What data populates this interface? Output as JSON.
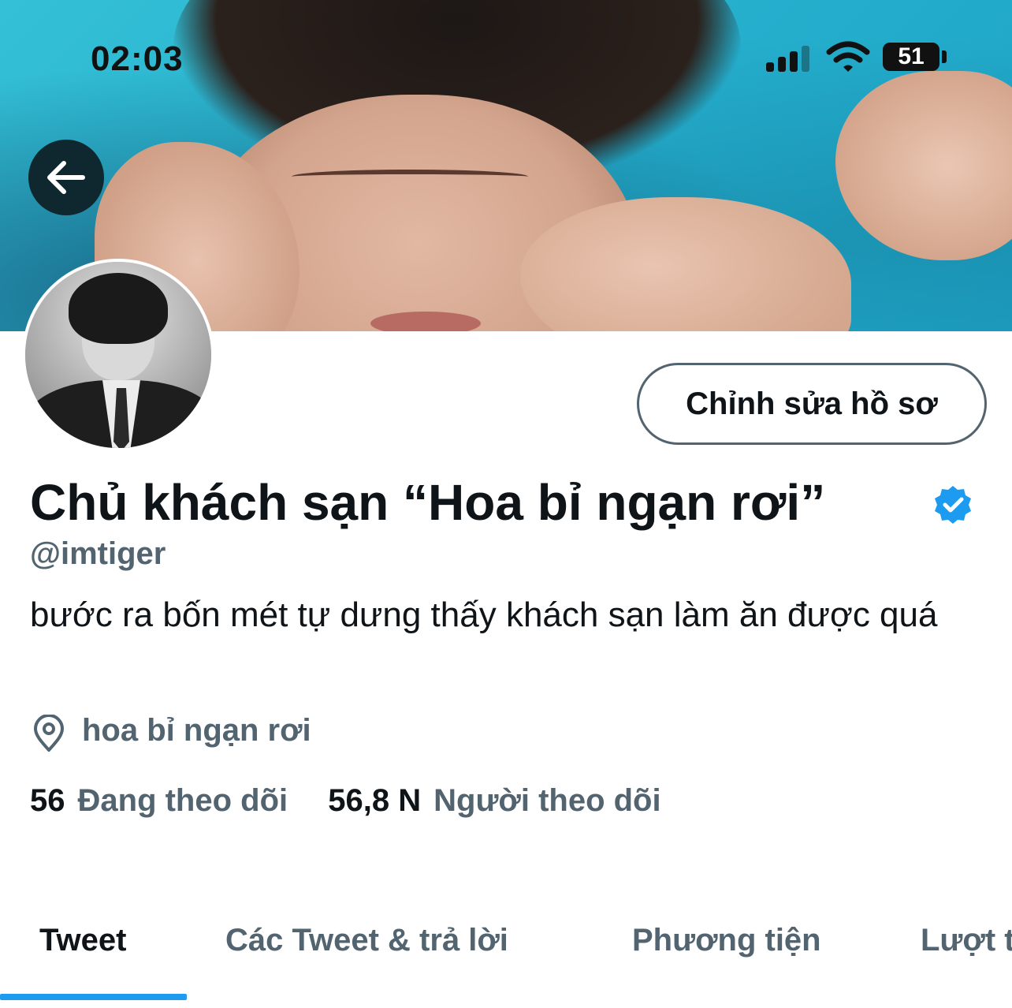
{
  "status_bar": {
    "time": "02:03",
    "battery": "51",
    "signal_icon": "cellular-signal-icon",
    "wifi_icon": "wifi-icon"
  },
  "header": {
    "back_icon": "arrow-left-icon"
  },
  "profile": {
    "edit_button_label": "Chỉnh sửa hồ sơ",
    "display_name": "Chủ khách sạn “Hoa bỉ ngạn rơi”",
    "verified_icon": "verified-badge-icon",
    "handle": "@imtiger",
    "bio": "bước ra bốn mét tự dưng thấy khách sạn làm ăn được quá",
    "location_icon": "location-pin-icon",
    "location": "hoa bỉ ngạn rơi",
    "following_count": "56",
    "following_label": "Đang theo dõi",
    "followers_count": "56,8 N",
    "followers_label": "Người theo dõi"
  },
  "tabs": [
    {
      "label": "Tweet",
      "active": true
    },
    {
      "label": "Các Tweet & trả lời",
      "active": false
    },
    {
      "label": "Phương tiện",
      "active": false
    },
    {
      "label": "Lượt thích",
      "active": false
    }
  ],
  "colors": {
    "accent": "#1d9bf0",
    "secondary_text": "#536471",
    "primary_text": "#0f1419"
  }
}
